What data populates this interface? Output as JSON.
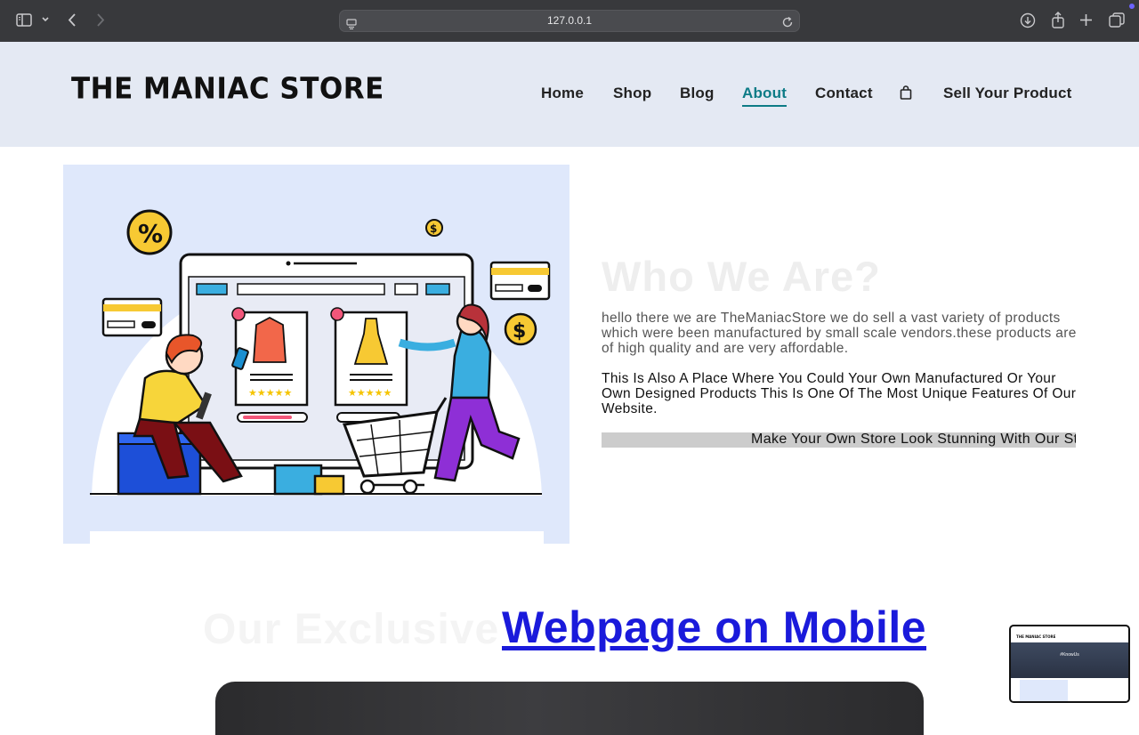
{
  "browser": {
    "url": "127.0.0.1",
    "icons": [
      "sidebar-icon",
      "chevron-down-icon",
      "back-icon",
      "forward-icon",
      "site-settings-icon",
      "reload-icon",
      "download-icon",
      "share-icon",
      "new-tab-icon",
      "tabs-overview-icon"
    ]
  },
  "header": {
    "logo": "THE MANIAC STORE",
    "nav": [
      {
        "label": "Home",
        "active": false
      },
      {
        "label": "Shop",
        "active": false
      },
      {
        "label": "Blog",
        "active": false
      },
      {
        "label": "About",
        "active": true
      },
      {
        "label": "Contact",
        "active": false
      },
      {
        "label": "Sell Your Product",
        "active": false
      }
    ],
    "cart_icon": "shopping-bag-icon",
    "accent_color": "#0d7b86"
  },
  "about": {
    "title": "Who We Are?",
    "paragraph1": "hello there we are TheManiacStore we do sell a vast variety of products which were been manufactured by small scale vendors.these products are of high quality and are very affordable.",
    "paragraph2": "This Is Also A Place Where You Could Your Own Manufactured Or Your Own Designed Products This Is One Of The Most Unique Features Of Our Website.",
    "marquee": "Make Your Own Store Look Stunning With Our St"
  },
  "exclusive": {
    "faded_title": "Our Exclusive",
    "link": "Webpage on Mobile"
  },
  "thumbnail": {
    "logo": "THE MANIAC STORE",
    "hero": "#KnowUs"
  }
}
